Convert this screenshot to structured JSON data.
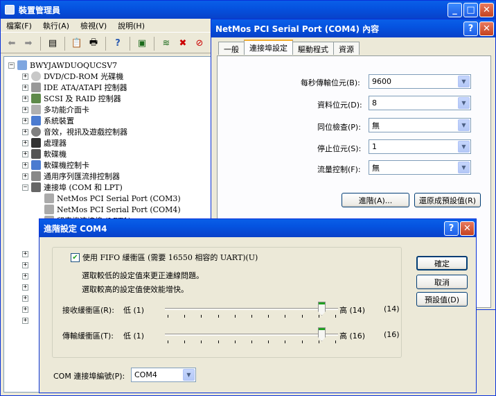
{
  "device_manager": {
    "title": "裝置管理員",
    "menu": [
      "檔案(F)",
      "執行(A)",
      "檢視(V)",
      "說明(H)"
    ],
    "tree": {
      "root": "BWYJAWDUOQUCSV7",
      "items": [
        "DVD/CD-ROM 光碟機",
        "IDE ATA/ATAPI 控制器",
        "SCSI 及 RAID 控制器",
        "多功能介面卡",
        "系統裝置",
        "音效，視訊及遊戲控制器",
        "處理器",
        "軟碟機",
        "軟碟機控制卡",
        "通用序列匯流排控制器",
        "連接埠 (COM 和 LPT)"
      ],
      "ports_children": [
        "NetMos PCI Serial Port (COM3)",
        "NetMos PCI Serial Port (COM4)",
        "印表機連接埠 (LPT1)"
      ]
    }
  },
  "properties": {
    "title": "NetMos PCI Serial Port (COM4) 內容",
    "tabs": [
      "一般",
      "連接埠設定",
      "驅動程式",
      "資源"
    ],
    "fields": [
      {
        "label": "每秒傳輸位元(B):",
        "value": "9600"
      },
      {
        "label": "資料位元(D):",
        "value": "8"
      },
      {
        "label": "同位檢查(P):",
        "value": "無"
      },
      {
        "label": "停止位元(S):",
        "value": "1"
      },
      {
        "label": "流量控制(F):",
        "value": "無"
      }
    ],
    "advanced_button": "進階(A)...",
    "restore_button": "還原成預設值(R)"
  },
  "advanced": {
    "title": "進階設定 COM4",
    "fifo_label": "使用 FIFO 緩衝區 (需要 16550 相容的 UART)(U)",
    "fifo_checked": true,
    "hint1": "選取較低的設定值來更正連線問題。",
    "hint2": "選取較高的設定值使效能增快。",
    "receive": {
      "label": "接收緩衝區(R):",
      "low": "低 (1)",
      "high": "高 (14)",
      "value": "(14)",
      "level": 1.0
    },
    "transmit": {
      "label": "傳輸緩衝區(T):",
      "low": "低 (1)",
      "high": "高 (16)",
      "value": "(16)",
      "level": 1.0
    },
    "com_label": "COM 連接埠編號(P):",
    "com_value": "COM4",
    "ok": "確定",
    "cancel": "取消",
    "defaults": "預設值(D)"
  },
  "colors": {
    "titlebar": "#0553e0",
    "window": "#ece9d8",
    "check": "#21a121"
  }
}
